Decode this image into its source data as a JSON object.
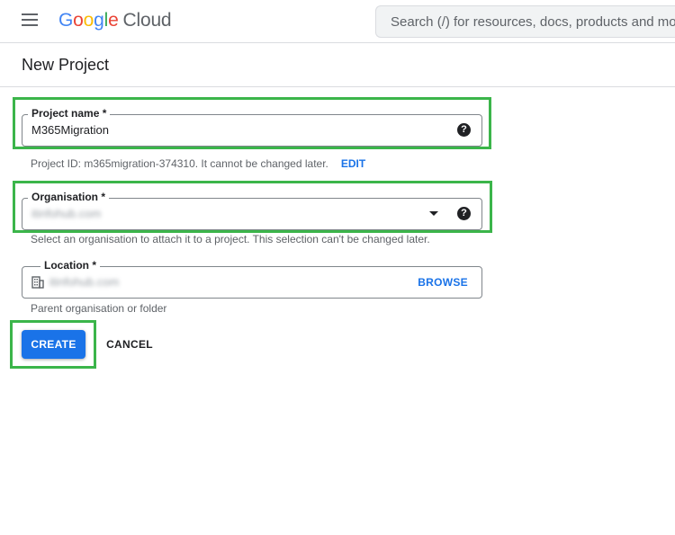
{
  "header": {
    "logo_letters": [
      "G",
      "o",
      "o",
      "g",
      "l",
      "e"
    ],
    "logo_product": "Cloud",
    "search_placeholder": "Search (/) for resources, docs, products and more"
  },
  "page": {
    "title": "New Project"
  },
  "form": {
    "project_name": {
      "label": "Project name *",
      "value": "M365Migration",
      "help": "?"
    },
    "project_id_hint": "Project ID: m365migration-374310. It cannot be changed later.",
    "edit_label": "EDIT",
    "organisation": {
      "label": "Organisation *",
      "value": "itinfohub.com",
      "help": "?",
      "hint": "Select an organisation to attach it to a project. This selection can't be changed later."
    },
    "location": {
      "label": "Location *",
      "value": "itinfohub.com",
      "browse_label": "BROWSE",
      "hint": "Parent organisation or folder"
    }
  },
  "actions": {
    "create_label": "CREATE",
    "cancel_label": "CANCEL"
  },
  "colors": {
    "accent": "#1a73e8",
    "highlight": "#3bb54a"
  }
}
